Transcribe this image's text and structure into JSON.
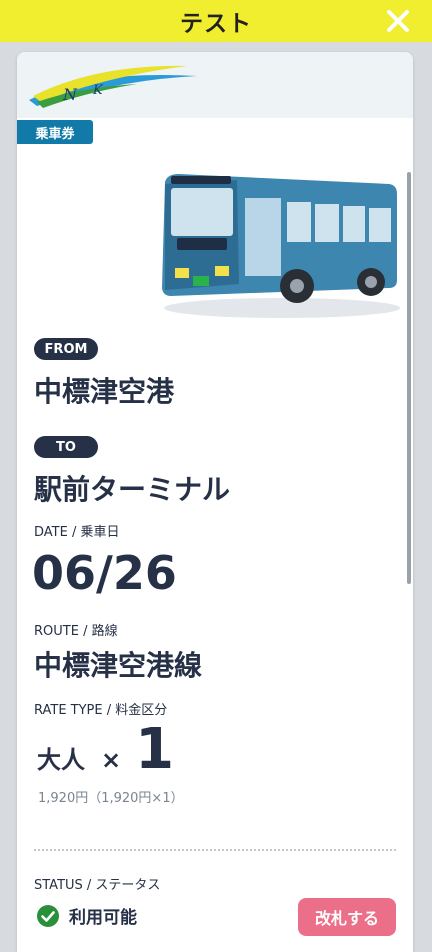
{
  "header": {
    "title": "テスト"
  },
  "ticket": {
    "tag": "乗車券",
    "logo_text": "Nemuro Kotsu",
    "from_label": "FROM",
    "from_value": "中標津空港",
    "to_label": "TO",
    "to_value": "駅前ターミナル",
    "date_label": "DATE / 乗車日",
    "date_value": "06/26",
    "route_label": "ROUTE / 路線",
    "route_value": "中標津空港線",
    "rate_label": "RATE TYPE / 料金区分",
    "rate_kind": "大人",
    "rate_times": "×",
    "rate_count": "1",
    "fare_detail": "1,920円（1,920円×1）",
    "status_label": "STATUS / ステータス",
    "status_value": "利用可能",
    "action_button": "改札する"
  },
  "colors": {
    "header_bg": "#f1ee2f",
    "tag_bg": "#127aa8",
    "pill_bg": "#263046",
    "button_bg": "#ec6f8a",
    "status_ok": "#2a8f3a"
  },
  "icons": {
    "close": "close-icon",
    "status": "check-circle-icon",
    "bus": "bus-illustration"
  }
}
